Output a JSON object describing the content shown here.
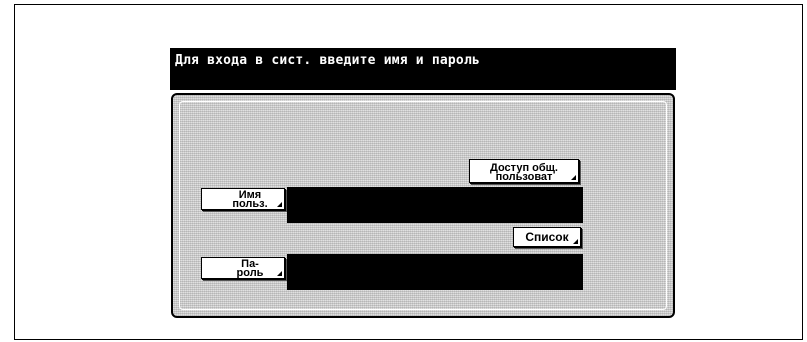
{
  "dialog": {
    "title": "Для входа в сист. введите имя и пароль"
  },
  "buttons": {
    "public_access": "Доступ общ.\nпользоват",
    "user_name": "Имя\nпольз.",
    "list": "Список",
    "password": "Па-\nроль"
  },
  "fields": {
    "user_name_value": "",
    "password_value": ""
  }
}
